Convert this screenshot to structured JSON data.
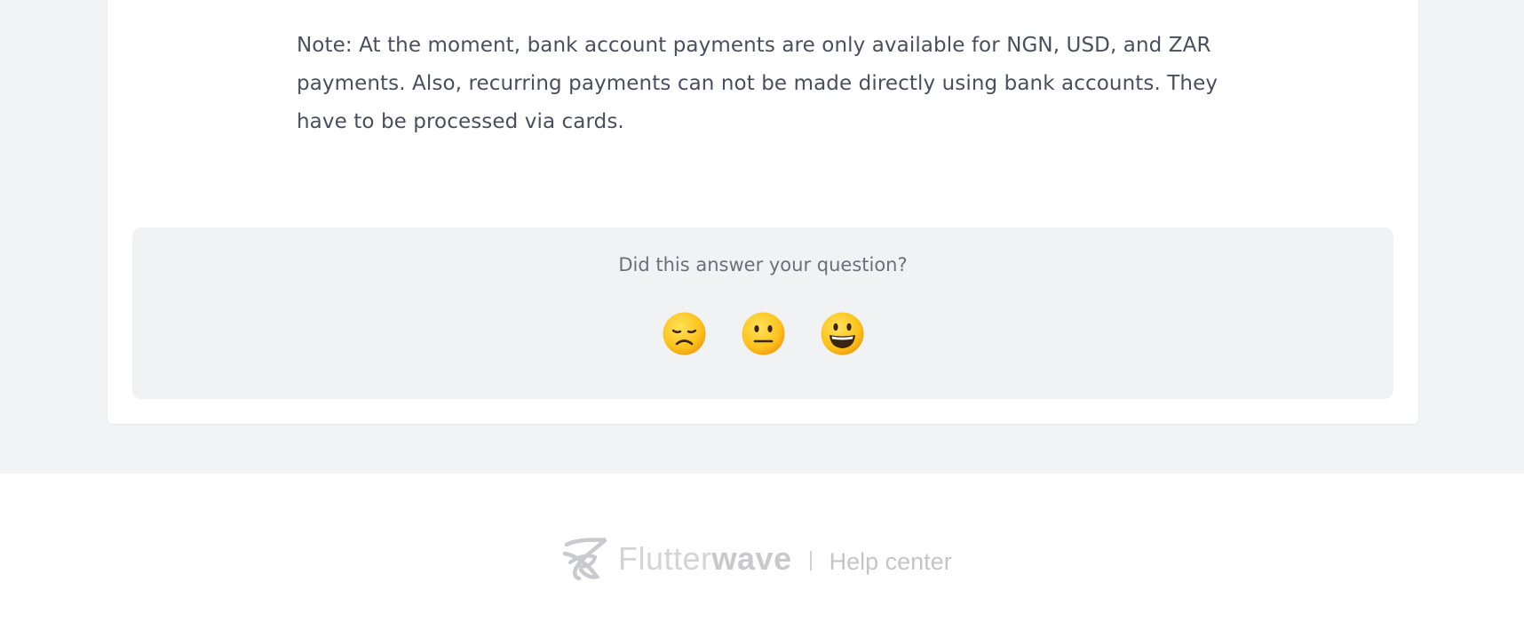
{
  "article": {
    "note": "Note: At the moment, bank account payments are only available for NGN, USD, and ZAR payments. Also, recurring payments can not be made directly using bank accounts. They have to be processed via cards."
  },
  "feedback": {
    "question": "Did this answer your question?",
    "reactions": [
      {
        "name": "disappointed",
        "icon": "disappointed-face-icon"
      },
      {
        "name": "neutral",
        "icon": "neutral-face-icon"
      },
      {
        "name": "smiley",
        "icon": "smiling-face-icon"
      }
    ]
  },
  "footer": {
    "brand_light": "Flutter",
    "brand_bold": "wave",
    "subtitle": "Help center",
    "logo_icon": "flutterwave-logo-icon"
  },
  "colors": {
    "background": "#f3f4f6",
    "card": "#ffffff",
    "text": "#4b4f5c",
    "feedback_bg": "#f1f2f4",
    "emoji_yellow": "#fcc21b",
    "footer_muted": "#d3d4d7"
  }
}
